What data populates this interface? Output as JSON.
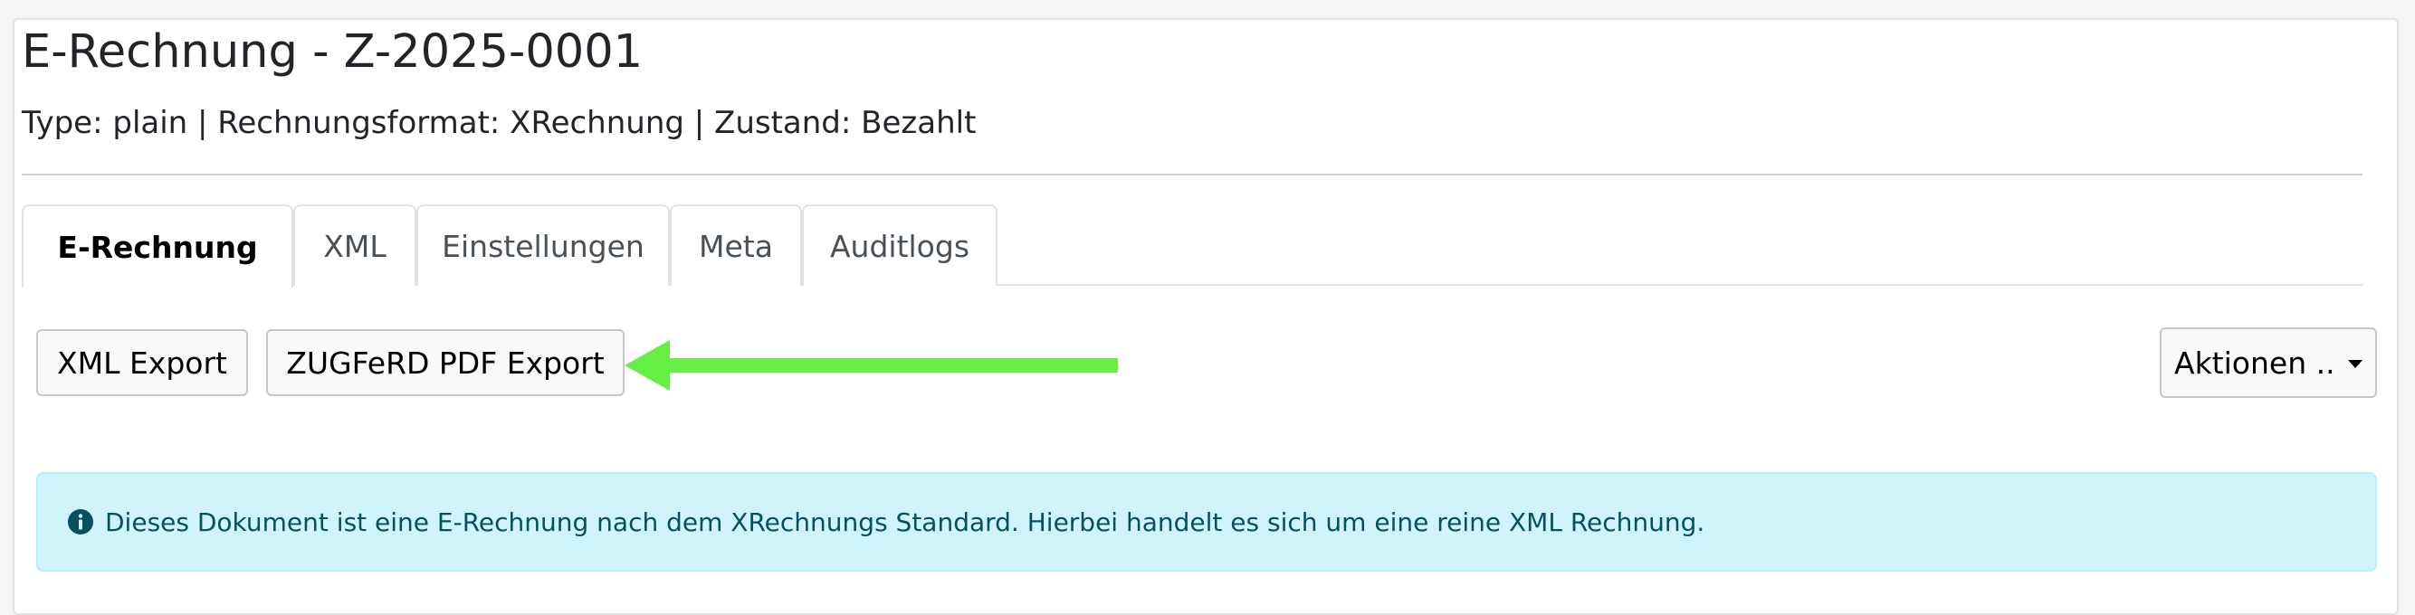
{
  "header": {
    "title": "E-Rechnung - Z-2025-0001",
    "subtitle": "Type: plain | Rechnungsformat: XRechnung | Zustand: Bezahlt"
  },
  "tabs": [
    {
      "label": "E-Rechnung",
      "active": true
    },
    {
      "label": "XML",
      "active": false
    },
    {
      "label": "Einstellungen",
      "active": false
    },
    {
      "label": "Meta",
      "active": false
    },
    {
      "label": "Auditlogs",
      "active": false
    }
  ],
  "toolbar": {
    "xml_export_label": "XML Export",
    "zugferd_export_label": "ZUGFeRD PDF Export",
    "actions_label": "Aktionen .."
  },
  "annotation": {
    "arrow_color": "#66ee44"
  },
  "alert": {
    "icon": "info-circle-icon",
    "text": "Dieses Dokument ist eine E-Rechnung nach dem XRechnungs Standard. Hierbei handelt es sich um eine reine XML Rechnung.",
    "background": "#cff4fc",
    "text_color": "#055160"
  }
}
